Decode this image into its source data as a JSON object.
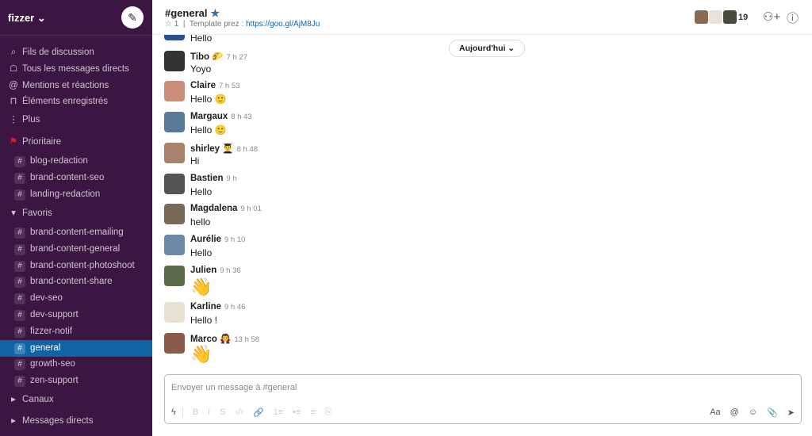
{
  "workspace": {
    "name": "fizzer",
    "chevron": "⌄",
    "compose_icon": "compose-icon"
  },
  "nav": [
    {
      "label": "Fils de discussion",
      "icon": "⌕"
    },
    {
      "label": "Tous les messages directs",
      "icon": "☖"
    },
    {
      "label": "Mentions et réactions",
      "icon": "@"
    },
    {
      "label": "Éléments enregistrés",
      "icon": "⊓"
    },
    {
      "label": "Plus",
      "icon": "⋮"
    }
  ],
  "prioritaire": {
    "label": "Prioritaire",
    "icon": "⚑",
    "color": "#e01e1e",
    "channels": [
      "blog-redaction",
      "brand-content-seo",
      "landing-redaction"
    ]
  },
  "favoris": {
    "label": "Favoris",
    "icon": "▾",
    "channels": [
      "brand-content-emailing",
      "brand-content-general",
      "brand-content-photoshoot",
      "brand-content-share",
      "dev-seo",
      "dev-support",
      "fizzer-notif",
      "general",
      "growth-seo",
      "zen-support"
    ],
    "selected": "general"
  },
  "canaux": {
    "label": "Canaux",
    "icon": "▸"
  },
  "dms": {
    "label": "Messages directs",
    "icon": "▸"
  },
  "header": {
    "title": "#general",
    "star": "★",
    "pins": "☆ 1",
    "topic_prefix": "Template prez :",
    "topic_link": "https://goo.gl/AjM8Ju",
    "member_count": "19",
    "add_icon": "⚇+",
    "info_icon": "ⓘ"
  },
  "day_divider": "Aujourd'hui ⌄",
  "messages": [
    {
      "name": "",
      "time": "",
      "text": "Hello",
      "color": "#2a4f8a"
    },
    {
      "name": "Tibo 🌮",
      "time": "7 h 27",
      "text": "Yoyo",
      "color": "#333"
    },
    {
      "name": "Claire",
      "time": "7 h 53",
      "text": "Hello 🙂",
      "color": "#c98f7a"
    },
    {
      "name": "Margaux",
      "time": "8 h 43",
      "text": "Hello 🙂",
      "color": "#5a7a99"
    },
    {
      "name": "shirley 👨‍🎓",
      "time": "8 h 48",
      "text": "Hi",
      "color": "#a8826a"
    },
    {
      "name": "Bastien",
      "time": "9 h",
      "text": "Hello",
      "color": "#555"
    },
    {
      "name": "Magdalena",
      "time": "9 h 01",
      "text": "hello",
      "color": "#7a6a5a"
    },
    {
      "name": "Aurélie",
      "time": "9 h 10",
      "text": "Hello",
      "color": "#6a8aa8"
    },
    {
      "name": "Julien",
      "time": "9 h 36",
      "text": "👋",
      "color": "#5a6a4a"
    },
    {
      "name": "Karline",
      "time": "9 h 46",
      "text": "Hello !",
      "color": "#e8e0d0"
    },
    {
      "name": "Marco 🧛",
      "time": "13 h 58",
      "text": "👋",
      "color": "#8a5a4a"
    }
  ],
  "composer": {
    "placeholder": "Envoyer un message à #general",
    "format": [
      "ϟ",
      "B",
      "I",
      "S",
      "‹/›",
      "🔗",
      "1≡",
      "•≡",
      "≡",
      "⎘"
    ],
    "right": [
      "Aa",
      "@",
      "☺",
      "📎",
      "➤"
    ]
  }
}
